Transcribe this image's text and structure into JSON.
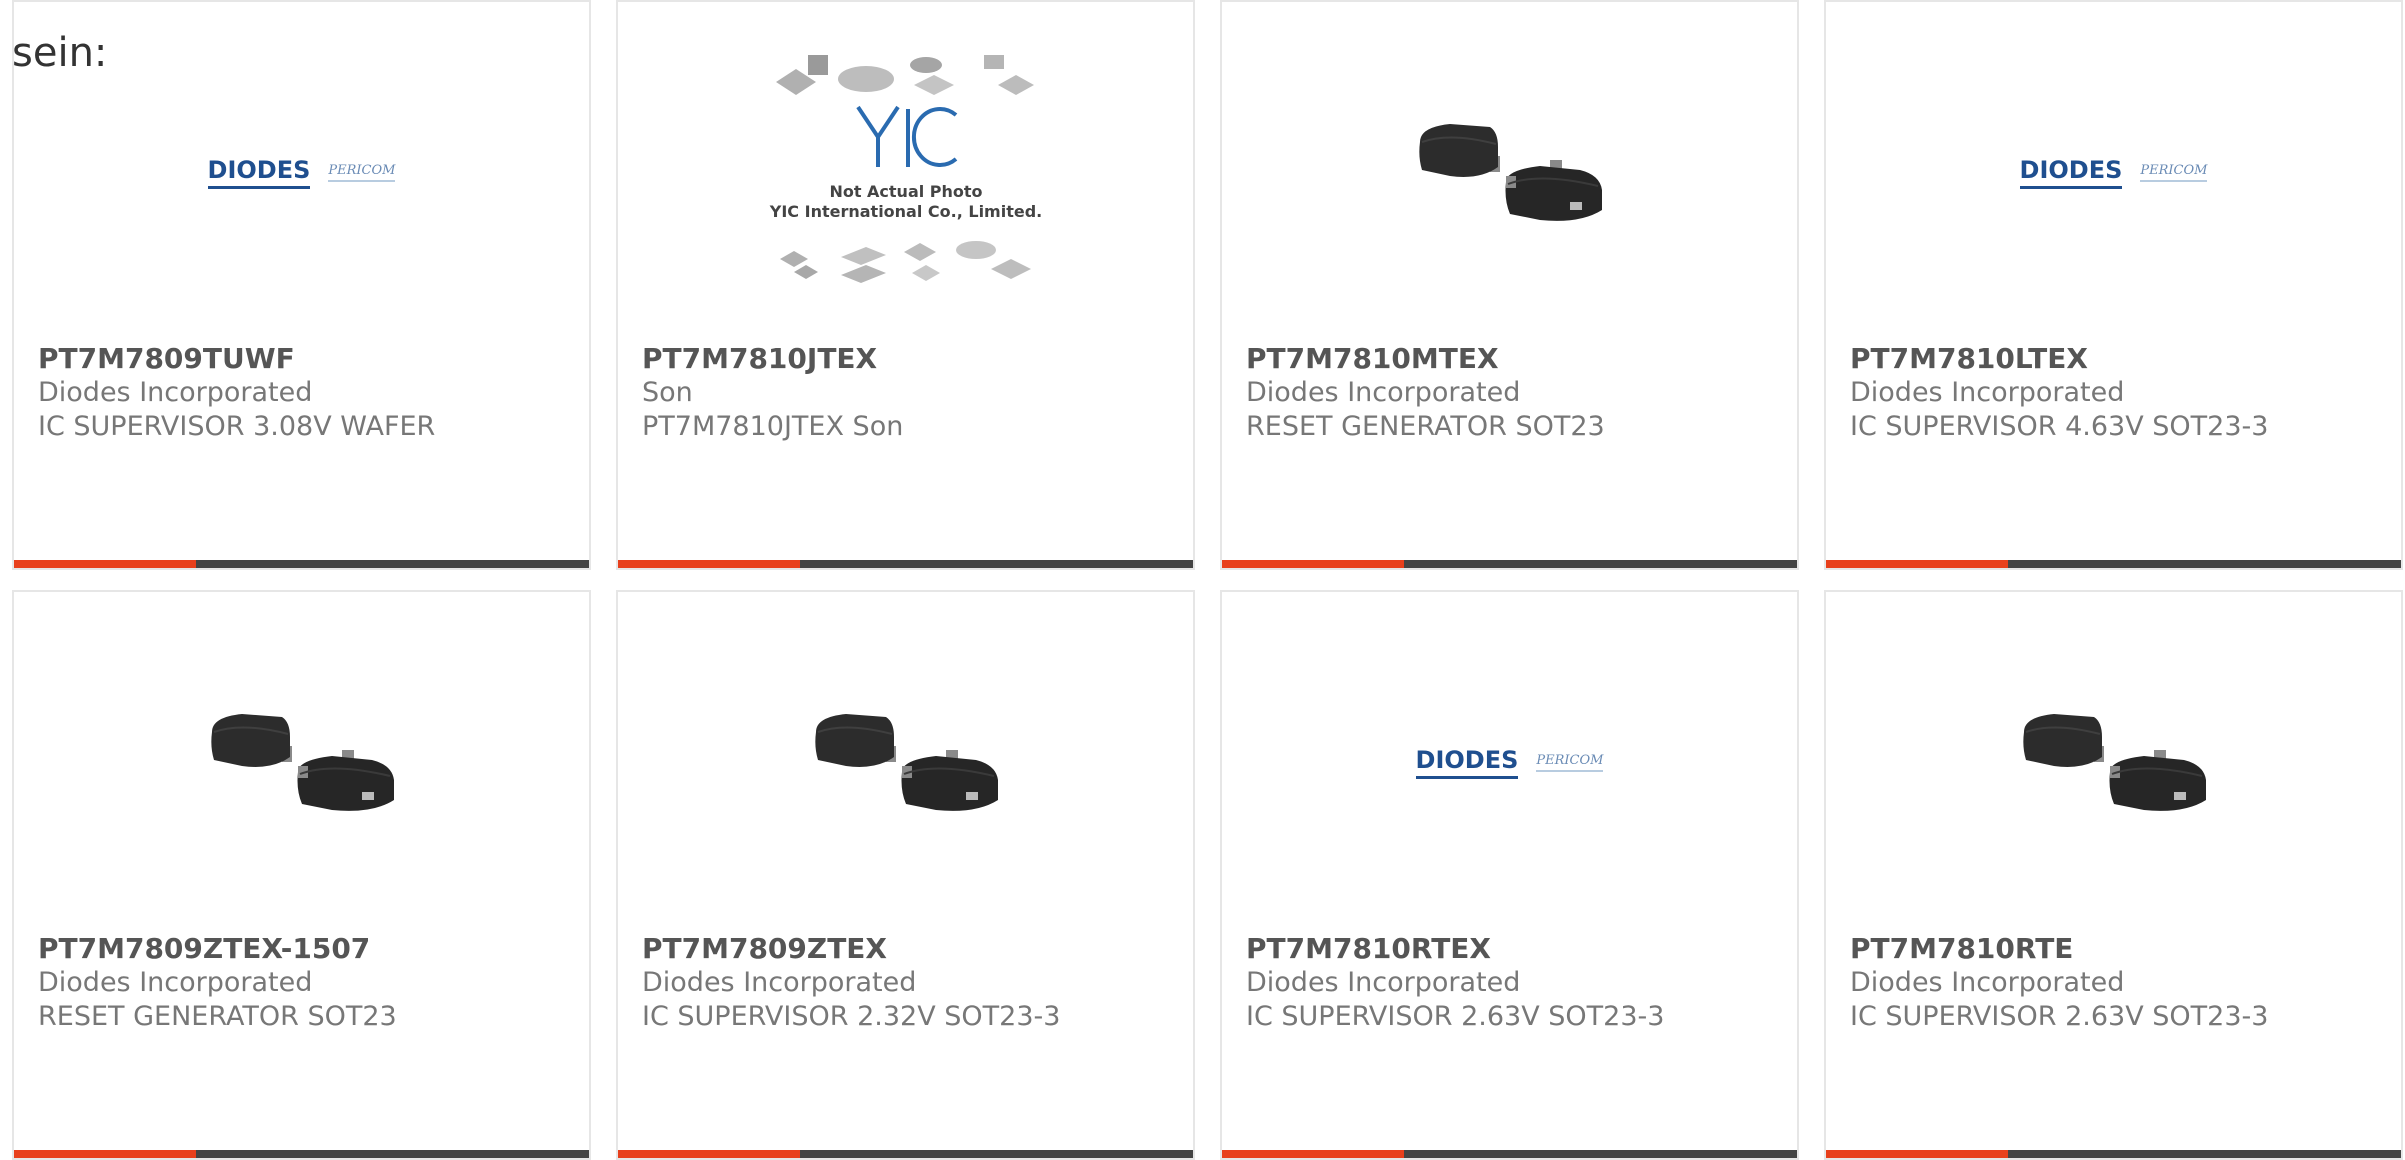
{
  "intro_text": "sein:",
  "colors": {
    "accent": "#e8401c",
    "bar": "#444444",
    "border": "#e6e6e6"
  },
  "logos": {
    "diodes": "DIODES",
    "pericom": "PERICOM",
    "yic_mark": "YIC",
    "yic_note_line1": "Not Actual Photo",
    "yic_note_line2": "YIC International Co., Limited."
  },
  "products": [
    {
      "part_number": "PT7M7809TUWF",
      "manufacturer": "Diodes Incorporated",
      "description": "IC SUPERVISOR 3.08V WAFER",
      "image": "diodes-pericom-logo"
    },
    {
      "part_number": "PT7M7810JTEX",
      "manufacturer": "Son",
      "description": "PT7M7810JTEX Son",
      "image": "yic-not-actual-photo"
    },
    {
      "part_number": "PT7M7810MTEX",
      "manufacturer": "Diodes Incorporated",
      "description": "RESET GENERATOR SOT23",
      "image": "sot23-package"
    },
    {
      "part_number": "PT7M7810LTEX",
      "manufacturer": "Diodes Incorporated",
      "description": "IC SUPERVISOR 4.63V SOT23-3",
      "image": "diodes-pericom-logo"
    },
    {
      "part_number": "PT7M7809ZTEX-1507",
      "manufacturer": "Diodes Incorporated",
      "description": "RESET GENERATOR SOT23",
      "image": "sot23-package"
    },
    {
      "part_number": "PT7M7809ZTEX",
      "manufacturer": "Diodes Incorporated",
      "description": "IC SUPERVISOR 2.32V SOT23-3",
      "image": "sot23-package"
    },
    {
      "part_number": "PT7M7810RTEX",
      "manufacturer": "Diodes Incorporated",
      "description": "IC SUPERVISOR 2.63V SOT23-3",
      "image": "diodes-pericom-logo"
    },
    {
      "part_number": "PT7M7810RTE",
      "manufacturer": "Diodes Incorporated",
      "description": "IC SUPERVISOR 2.63V SOT23-3",
      "image": "sot23-package"
    }
  ]
}
